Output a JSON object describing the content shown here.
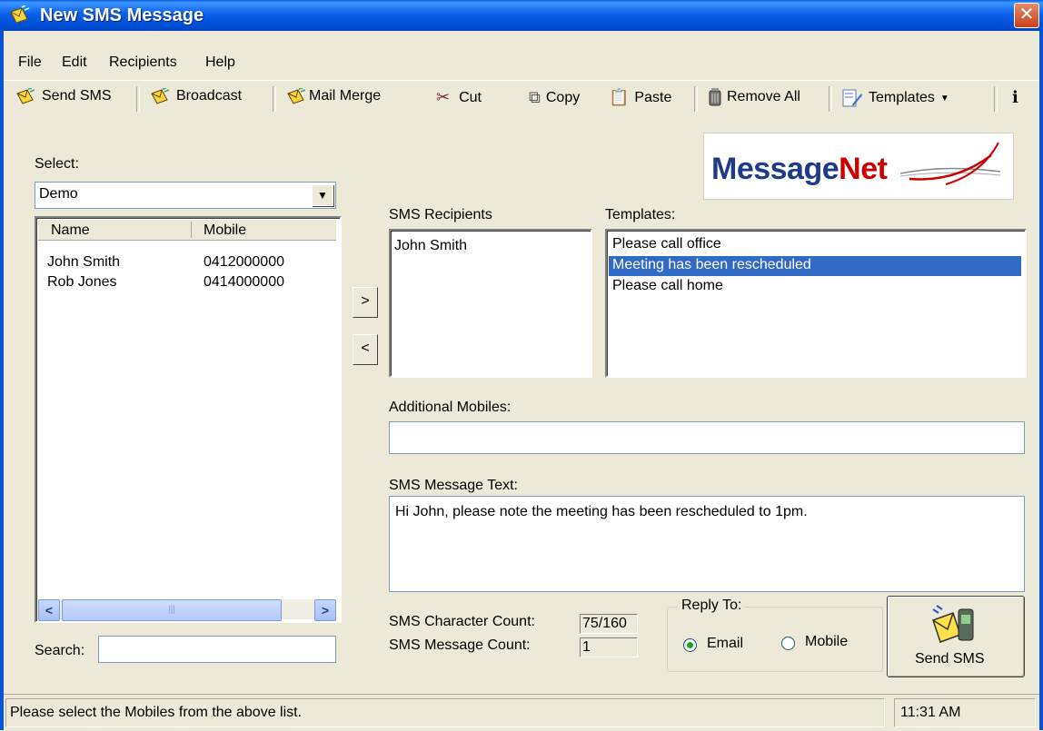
{
  "window": {
    "title": "New SMS Message"
  },
  "menu": [
    "File",
    "Edit",
    "Recipients",
    "Help"
  ],
  "toolbar": {
    "send_sms": "Send SMS",
    "broadcast": "Broadcast",
    "mail_merge": "Mail Merge",
    "cut": "Cut",
    "copy": "Copy",
    "paste": "Paste",
    "remove_all": "Remove All",
    "templates": "Templates"
  },
  "logo": {
    "part1": "Message",
    "part2": "Net"
  },
  "select": {
    "label": "Select:",
    "value": "Demo"
  },
  "contacts": {
    "columns": [
      "Name",
      "Mobile"
    ],
    "rows": [
      {
        "name": "John Smith",
        "mobile": "0412000000"
      },
      {
        "name": "Rob Jones",
        "mobile": "0414000000"
      }
    ]
  },
  "search": {
    "label": "Search:",
    "value": ""
  },
  "recipients": {
    "label": "SMS Recipients",
    "items": [
      "John Smith"
    ]
  },
  "templates": {
    "label": "Templates:",
    "items": [
      "Please call office",
      "Meeting has been rescheduled",
      "Please call home"
    ],
    "selected_index": 1
  },
  "additional_mobiles": {
    "label": "Additional Mobiles:",
    "value": ""
  },
  "message": {
    "label": "SMS Message Text:",
    "value": "Hi John, please note the meeting has been rescheduled to 1pm."
  },
  "counts": {
    "char_label": "SMS Character Count:",
    "char_value": "75/160",
    "msg_label": "SMS Message Count:",
    "msg_value": "1"
  },
  "reply_to": {
    "label": "Reply To:",
    "email": "Email",
    "mobile": "Mobile",
    "selected": "Email"
  },
  "send_button": {
    "label": "Send SMS"
  },
  "status": {
    "message": "Please select the Mobiles from the above list.",
    "time": "11:31 AM"
  },
  "colors": {
    "title_bar": "#0a5ce0",
    "selection": "#316ac5",
    "logo_red": "#cc0000",
    "logo_blue": "#1f3a8a"
  }
}
